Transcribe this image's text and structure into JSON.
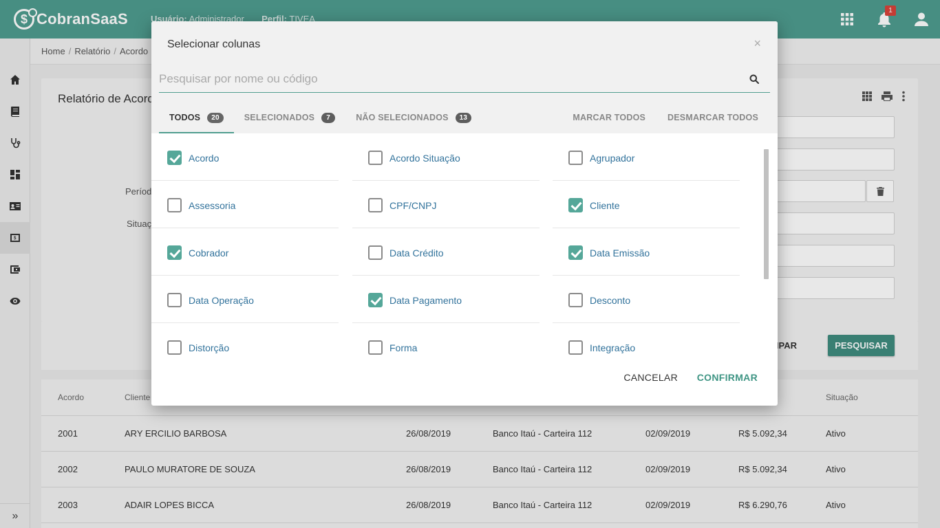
{
  "app": {
    "logo": "CobranSaaS",
    "user_label": "Usuário:",
    "user_value": "Administrador",
    "profile_label": "Perfil:",
    "profile_value": "TIVEA",
    "notif_count": "1"
  },
  "breadcrumb": [
    "Home",
    "Relatório",
    "Acordo"
  ],
  "card": {
    "title": "Relatório de Acordo",
    "label_periodo": "Período",
    "label_situacao": "Situação"
  },
  "actions": {
    "limpar": "LIMPAR",
    "pesquisar": "PESQUISAR"
  },
  "table": {
    "headers": [
      "Acordo",
      "Cliente",
      "Situação"
    ],
    "rows": [
      {
        "acordo": "2001",
        "cliente": "ARY ERCILIO BARBOSA",
        "data1": "26/08/2019",
        "banco": "Banco Itaú - Carteira 112",
        "data2": "02/09/2019",
        "valor": "R$ 5.092,34",
        "situacao": "Ativo"
      },
      {
        "acordo": "2002",
        "cliente": "PAULO MURATORE DE SOUZA",
        "data1": "26/08/2019",
        "banco": "Banco Itaú - Carteira 112",
        "data2": "02/09/2019",
        "valor": "R$ 5.092,34",
        "situacao": "Ativo"
      },
      {
        "acordo": "2003",
        "cliente": "ADAIR LOPES BICCA",
        "data1": "26/08/2019",
        "banco": "Banco Itaú - Carteira 112",
        "data2": "02/09/2019",
        "valor": "R$ 6.290,76",
        "situacao": "Ativo"
      }
    ]
  },
  "modal": {
    "title": "Selecionar colunas",
    "close": "×",
    "search_placeholder": "Pesquisar por nome ou código",
    "search_value": "",
    "tabs": [
      {
        "label": "TODOS",
        "count": "20"
      },
      {
        "label": "SELECIONADOS",
        "count": "7"
      },
      {
        "label": "NÃO SELECIONADOS",
        "count": "13"
      }
    ],
    "mark_all": "MARCAR TODOS",
    "unmark_all": "DESMARCAR TODOS",
    "columns": [
      {
        "label": "Acordo",
        "checked": true
      },
      {
        "label": "Acordo Situação",
        "checked": false
      },
      {
        "label": "Agrupador",
        "checked": false
      },
      {
        "label": "Assessoria",
        "checked": false
      },
      {
        "label": "CPF/CNPJ",
        "checked": false
      },
      {
        "label": "Cliente",
        "checked": true
      },
      {
        "label": "Cobrador",
        "checked": true
      },
      {
        "label": "Data Crédito",
        "checked": false
      },
      {
        "label": "Data Emissão",
        "checked": true
      },
      {
        "label": "Data Operação",
        "checked": false
      },
      {
        "label": "Data Pagamento",
        "checked": true
      },
      {
        "label": "Desconto",
        "checked": false
      },
      {
        "label": "Distorção",
        "checked": false
      },
      {
        "label": "Forma",
        "checked": false
      },
      {
        "label": "Integração",
        "checked": false
      }
    ],
    "cancel": "CANCELAR",
    "confirm": "CONFIRMAR"
  },
  "colors": {
    "primary": "#4f9d8f",
    "checkbox": "#55a799",
    "link": "#31729b",
    "badge": "#d9433a"
  },
  "icons": {
    "topbar": [
      "apps-grid-icon",
      "bell-icon",
      "user-icon"
    ],
    "sidebar": [
      "home-icon",
      "book-icon",
      "stethoscope-icon",
      "dashboard-icon",
      "contact-card-icon",
      "money-icon",
      "wallet-icon",
      "eye-icon"
    ]
  }
}
